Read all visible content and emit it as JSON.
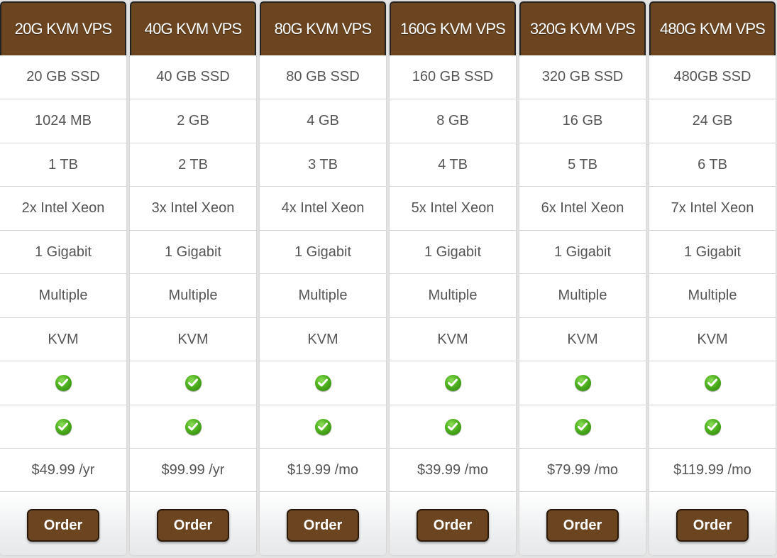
{
  "plans": [
    {
      "name": "20G KVM VPS",
      "disk": "20 GB SSD",
      "ram": "1024 MB",
      "bandwidth": "1 TB",
      "cpu": "2x Intel Xeon",
      "port": "1 Gigabit",
      "ips": "Multiple",
      "virtualization": "KVM",
      "check1": true,
      "check2": true,
      "price": "$49.99 /yr",
      "order_label": "Order"
    },
    {
      "name": "40G KVM VPS",
      "disk": "40 GB SSD",
      "ram": "2 GB",
      "bandwidth": "2 TB",
      "cpu": "3x Intel Xeon",
      "port": "1 Gigabit",
      "ips": "Multiple",
      "virtualization": "KVM",
      "check1": true,
      "check2": true,
      "price": "$99.99 /yr",
      "order_label": "Order"
    },
    {
      "name": "80G KVM VPS",
      "disk": "80 GB SSD",
      "ram": "4 GB",
      "bandwidth": "3 TB",
      "cpu": "4x Intel Xeon",
      "port": "1 Gigabit",
      "ips": "Multiple",
      "virtualization": "KVM",
      "check1": true,
      "check2": true,
      "price": "$19.99 /mo",
      "order_label": "Order"
    },
    {
      "name": "160G KVM VPS",
      "disk": "160 GB SSD",
      "ram": "8 GB",
      "bandwidth": "4 TB",
      "cpu": "5x Intel Xeon",
      "port": "1 Gigabit",
      "ips": "Multiple",
      "virtualization": "KVM",
      "check1": true,
      "check2": true,
      "price": "$39.99 /mo",
      "order_label": "Order"
    },
    {
      "name": "320G KVM VPS",
      "disk": "320 GB SSD",
      "ram": "16 GB",
      "bandwidth": "5 TB",
      "cpu": "6x Intel Xeon",
      "port": "1 Gigabit",
      "ips": "Multiple",
      "virtualization": "KVM",
      "check1": true,
      "check2": true,
      "price": "$79.99 /mo",
      "order_label": "Order"
    },
    {
      "name": "480G KVM VPS",
      "disk": "480GB SSD",
      "ram": "24 GB",
      "bandwidth": "6 TB",
      "cpu": "7x Intel Xeon",
      "port": "1 Gigabit",
      "ips": "Multiple",
      "virtualization": "KVM",
      "check1": true,
      "check2": true,
      "price": "$119.99 /mo",
      "order_label": "Order"
    }
  ],
  "icons": {
    "feature_included": "check-circle-icon"
  },
  "colors": {
    "header_bg": "#6b4520",
    "button_bg": "#6b4520",
    "check_green": "#4caf1c",
    "cell_text": "#555555",
    "page_bg": "#e3e3e3"
  }
}
